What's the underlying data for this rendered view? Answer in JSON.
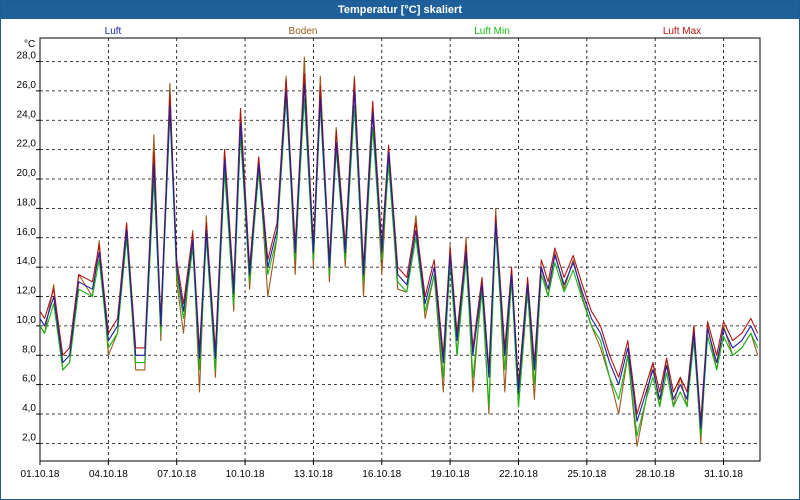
{
  "window": {
    "title": "Temperatur [°C] skaliert"
  },
  "colors": {
    "Luft": "#1f1fa8",
    "Boden": "#9a5a1a",
    "Luft Min": "#14b814",
    "Luft Max": "#b01515",
    "grid": "#000000",
    "frame": "#1f5f9a"
  },
  "chart_data": {
    "type": "line",
    "title": "Temperatur [°C] skaliert",
    "ylabel": "°C",
    "xlabel": "",
    "ylim": [
      0.8,
      29.6
    ],
    "xlim": [
      1,
      32.6
    ],
    "yticks": [
      2.0,
      4.0,
      6.0,
      8.0,
      10.0,
      12.0,
      14.0,
      16.0,
      18.0,
      20.0,
      22.0,
      24.0,
      26.0,
      28.0
    ],
    "ytick_labels": [
      "2,0",
      "4,0",
      "6,0",
      "8,0",
      "10,0",
      "12,0",
      "14,0",
      "16,0",
      "18,0",
      "20,0",
      "22,0",
      "24,0",
      "26,0",
      "28,0"
    ],
    "xticks": [
      1,
      4,
      7,
      10,
      13,
      16,
      19,
      22,
      25,
      28,
      31
    ],
    "xtick_labels": [
      "01.10.18",
      "04.10.18",
      "07.10.18",
      "10.10.18",
      "13.10.18",
      "16.10.18",
      "19.10.18",
      "22.10.18",
      "25.10.18",
      "28.10.18",
      "31.10.18"
    ],
    "grid": true,
    "legend_position": "top",
    "series": [
      {
        "name": "Luft",
        "x": [
          1.0,
          1.2,
          1.6,
          2.0,
          2.3,
          2.7,
          3.3,
          3.6,
          4.0,
          4.4,
          4.8,
          5.2,
          5.6,
          6.0,
          6.3,
          6.7,
          7.0,
          7.3,
          7.7,
          8.0,
          8.3,
          8.7,
          9.1,
          9.5,
          9.8,
          10.2,
          10.6,
          11.0,
          11.4,
          11.8,
          12.2,
          12.6,
          13.0,
          13.3,
          13.7,
          14.0,
          14.4,
          14.8,
          15.2,
          15.6,
          16.0,
          16.3,
          16.7,
          17.1,
          17.5,
          17.9,
          18.3,
          18.7,
          19.0,
          19.3,
          19.7,
          20.0,
          20.4,
          20.7,
          21.0,
          21.4,
          21.7,
          22.0,
          22.4,
          22.7,
          23.0,
          23.3,
          23.6,
          24.0,
          24.4,
          24.8,
          25.2,
          25.6,
          26.0,
          26.4,
          26.8,
          27.2,
          27.6,
          27.9,
          28.2,
          28.5,
          28.8,
          29.1,
          29.4,
          29.7,
          30.0,
          30.3,
          30.7,
          31.0,
          31.4,
          31.8,
          32.2,
          32.5
        ],
        "y": [
          10.5,
          10.0,
          12.0,
          7.5,
          8.0,
          13.0,
          12.5,
          15.0,
          9.0,
          10.0,
          16.5,
          8.0,
          8.0,
          21.0,
          10.0,
          25.0,
          14.0,
          11.0,
          15.8,
          7.8,
          16.5,
          7.8,
          21.3,
          12.2,
          23.8,
          13.5,
          21.0,
          14.0,
          16.5,
          26.0,
          15.0,
          26.5,
          15.0,
          25.5,
          14.0,
          22.5,
          15.0,
          26.0,
          13.5,
          24.5,
          15.0,
          21.8,
          13.5,
          12.8,
          16.5,
          11.5,
          14.0,
          7.5,
          14.8,
          9.0,
          15.0,
          8.0,
          12.8,
          6.5,
          17.0,
          8.0,
          13.5,
          5.5,
          12.8,
          7.0,
          14.0,
          12.5,
          14.8,
          12.8,
          14.3,
          12.3,
          10.5,
          9.5,
          7.5,
          6.0,
          8.5,
          3.5,
          5.5,
          7.0,
          5.0,
          7.3,
          5.0,
          6.0,
          5.0,
          9.5,
          3.0,
          9.8,
          7.5,
          9.8,
          8.5,
          9.0,
          10.0,
          9.0
        ]
      },
      {
        "name": "Boden",
        "x": [
          1.0,
          1.2,
          1.6,
          2.0,
          2.3,
          2.7,
          3.3,
          3.6,
          4.0,
          4.4,
          4.8,
          5.2,
          5.6,
          6.0,
          6.3,
          6.7,
          7.0,
          7.3,
          7.7,
          8.0,
          8.3,
          8.7,
          9.1,
          9.5,
          9.8,
          10.2,
          10.6,
          11.0,
          11.4,
          11.8,
          12.2,
          12.6,
          13.0,
          13.3,
          13.7,
          14.0,
          14.4,
          14.8,
          15.2,
          15.6,
          16.0,
          16.3,
          16.7,
          17.1,
          17.5,
          17.9,
          18.3,
          18.7,
          19.0,
          19.3,
          19.7,
          20.0,
          20.4,
          20.7,
          21.0,
          21.4,
          21.7,
          22.0,
          22.4,
          22.7,
          23.0,
          23.3,
          23.6,
          24.0,
          24.4,
          24.8,
          25.2,
          25.6,
          26.0,
          26.4,
          26.8,
          27.2,
          27.6,
          27.9,
          28.2,
          28.5,
          28.8,
          29.1,
          29.4,
          29.7,
          30.0,
          30.3,
          30.7,
          31.0,
          31.4,
          31.8,
          32.2,
          32.5
        ],
        "y": [
          10.0,
          9.5,
          12.8,
          7.0,
          7.5,
          13.5,
          12.0,
          15.8,
          8.0,
          9.5,
          17.0,
          7.0,
          7.0,
          23.0,
          9.0,
          26.5,
          13.0,
          9.5,
          16.5,
          5.5,
          17.5,
          6.5,
          22.0,
          11.0,
          24.5,
          12.5,
          21.5,
          12.0,
          16.0,
          27.0,
          13.5,
          28.3,
          14.0,
          27.0,
          13.0,
          23.5,
          14.0,
          27.0,
          12.0,
          25.0,
          13.5,
          21.5,
          12.5,
          12.3,
          17.5,
          10.5,
          13.5,
          5.5,
          15.5,
          8.0,
          16.0,
          5.5,
          13.0,
          4.0,
          18.0,
          5.5,
          13.5,
          4.5,
          12.5,
          5.0,
          14.0,
          12.0,
          15.0,
          12.5,
          14.5,
          12.0,
          10.0,
          8.5,
          6.5,
          4.0,
          8.0,
          1.8,
          5.0,
          7.5,
          4.5,
          7.8,
          4.5,
          6.5,
          4.5,
          10.0,
          2.0,
          10.0,
          7.0,
          10.0,
          8.0,
          8.5,
          9.5,
          8.0
        ]
      },
      {
        "name": "Luft Min",
        "x": [
          1.0,
          1.2,
          1.6,
          2.0,
          2.3,
          2.7,
          3.3,
          3.6,
          4.0,
          4.4,
          4.8,
          5.2,
          5.6,
          6.0,
          6.3,
          6.7,
          7.0,
          7.3,
          7.7,
          8.0,
          8.3,
          8.7,
          9.1,
          9.5,
          9.8,
          10.2,
          10.6,
          11.0,
          11.4,
          11.8,
          12.2,
          12.6,
          13.0,
          13.3,
          13.7,
          14.0,
          14.4,
          14.8,
          15.2,
          15.6,
          16.0,
          16.3,
          16.7,
          17.1,
          17.5,
          17.9,
          18.3,
          18.7,
          19.0,
          19.3,
          19.7,
          20.0,
          20.4,
          20.7,
          21.0,
          21.4,
          21.7,
          22.0,
          22.4,
          22.7,
          23.0,
          23.3,
          23.6,
          24.0,
          24.4,
          24.8,
          25.2,
          25.6,
          26.0,
          26.4,
          26.8,
          27.2,
          27.6,
          27.9,
          28.2,
          28.5,
          28.8,
          29.1,
          29.4,
          29.7,
          30.0,
          30.3,
          30.7,
          31.0,
          31.4,
          31.8,
          32.2,
          32.5
        ],
        "y": [
          10.0,
          9.5,
          11.5,
          7.0,
          7.5,
          12.5,
          12.0,
          14.5,
          8.5,
          9.5,
          16.0,
          7.5,
          7.5,
          20.0,
          9.5,
          24.5,
          13.5,
          10.5,
          15.3,
          7.0,
          16.0,
          7.0,
          20.5,
          11.5,
          23.0,
          13.0,
          20.5,
          13.5,
          16.0,
          25.5,
          14.5,
          25.5,
          14.5,
          25.0,
          13.5,
          22.0,
          14.5,
          25.0,
          13.0,
          23.5,
          14.5,
          21.0,
          13.0,
          12.3,
          16.0,
          11.0,
          13.5,
          6.5,
          14.3,
          8.0,
          14.5,
          6.5,
          12.3,
          4.5,
          16.5,
          7.0,
          13.0,
          4.5,
          12.3,
          6.0,
          13.5,
          12.0,
          14.3,
          12.3,
          13.8,
          11.8,
          10.0,
          9.0,
          6.5,
          5.0,
          8.0,
          2.5,
          5.0,
          6.5,
          4.5,
          6.8,
          4.5,
          5.5,
          4.5,
          9.0,
          2.5,
          9.3,
          7.0,
          9.3,
          8.0,
          8.5,
          9.5,
          8.5
        ]
      },
      {
        "name": "Luft Max",
        "x": [
          1.0,
          1.2,
          1.6,
          2.0,
          2.3,
          2.7,
          3.3,
          3.6,
          4.0,
          4.4,
          4.8,
          5.2,
          5.6,
          6.0,
          6.3,
          6.7,
          7.0,
          7.3,
          7.7,
          8.0,
          8.3,
          8.7,
          9.1,
          9.5,
          9.8,
          10.2,
          10.6,
          11.0,
          11.4,
          11.8,
          12.2,
          12.6,
          13.0,
          13.3,
          13.7,
          14.0,
          14.4,
          14.8,
          15.2,
          15.6,
          16.0,
          16.3,
          16.7,
          17.1,
          17.5,
          17.9,
          18.3,
          18.7,
          19.0,
          19.3,
          19.7,
          20.0,
          20.4,
          20.7,
          21.0,
          21.4,
          21.7,
          22.0,
          22.4,
          22.7,
          23.0,
          23.3,
          23.6,
          24.0,
          24.4,
          24.8,
          25.2,
          25.6,
          26.0,
          26.4,
          26.8,
          27.2,
          27.6,
          27.9,
          28.2,
          28.5,
          28.8,
          29.1,
          29.4,
          29.7,
          30.0,
          30.3,
          30.7,
          31.0,
          31.4,
          31.8,
          32.2,
          32.5
        ],
        "y": [
          11.0,
          10.5,
          12.5,
          8.0,
          8.5,
          13.5,
          13.0,
          15.5,
          9.5,
          10.5,
          17.0,
          8.5,
          8.5,
          21.8,
          10.5,
          25.8,
          14.5,
          11.5,
          16.3,
          8.3,
          17.0,
          8.3,
          22.0,
          12.7,
          24.8,
          14.0,
          21.5,
          14.5,
          17.0,
          26.8,
          15.5,
          27.2,
          15.5,
          26.3,
          14.5,
          23.3,
          15.5,
          26.8,
          14.0,
          25.3,
          15.5,
          22.3,
          14.0,
          13.3,
          17.0,
          12.0,
          14.5,
          8.0,
          15.3,
          9.5,
          15.5,
          8.5,
          13.3,
          7.0,
          17.5,
          8.5,
          14.0,
          6.0,
          13.3,
          7.5,
          14.5,
          13.0,
          15.3,
          13.3,
          14.8,
          12.8,
          11.0,
          10.0,
          8.0,
          6.5,
          9.0,
          4.0,
          6.0,
          7.5,
          5.5,
          7.8,
          5.5,
          6.5,
          5.5,
          10.0,
          3.5,
          10.3,
          8.0,
          10.3,
          9.0,
          9.5,
          10.5,
          9.5
        ]
      }
    ]
  }
}
